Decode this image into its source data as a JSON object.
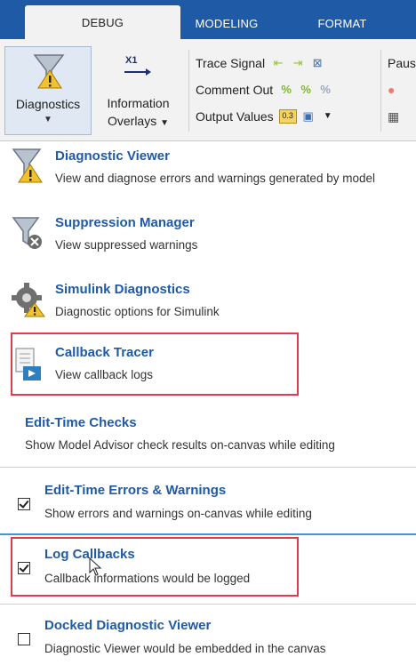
{
  "tabs": [
    {
      "label": "DEBUG",
      "active": true
    },
    {
      "label": "MODELING",
      "active": false
    },
    {
      "label": "FORMAT",
      "active": false
    }
  ],
  "toolstrip": {
    "diagnostics_label": "Diagnostics",
    "info_overlays_line1": "Information",
    "info_overlays_line2": "Overlays",
    "x1_glyph": "X1",
    "trace_signal": "Trace Signal",
    "comment_out": "Comment Out",
    "output_values": "Output Values",
    "pause_truncated": "Paus"
  },
  "menu": {
    "diagnostic_viewer": {
      "title": "Diagnostic Viewer",
      "desc": "View and diagnose errors and warnings generated by model"
    },
    "suppression_manager": {
      "title": "Suppression Manager",
      "desc": "View suppressed warnings"
    },
    "simulink_diagnostics": {
      "title": "Simulink Diagnostics",
      "desc": "Diagnostic options for Simulink"
    },
    "callback_tracer": {
      "title": "Callback Tracer",
      "desc": "View callback logs"
    },
    "edit_time_checks": {
      "title": "Edit-Time Checks",
      "desc": "Show Model Advisor check results on-canvas while editing"
    },
    "edit_time_errors": {
      "title": "Edit-Time Errors & Warnings",
      "desc": "Show errors and warnings on-canvas while editing",
      "checked": true
    },
    "log_callbacks": {
      "title": "Log Callbacks",
      "desc": "Callback informations would be logged",
      "checked": true
    },
    "docked_viewer": {
      "title": "Docked Diagnostic Viewer",
      "desc": "Diagnostic Viewer would be embedded in the canvas",
      "checked": false
    }
  },
  "colors": {
    "tab_bar": "#1f5aa6",
    "title_link": "#1f5aa6",
    "highlight": "#e03b4b"
  }
}
